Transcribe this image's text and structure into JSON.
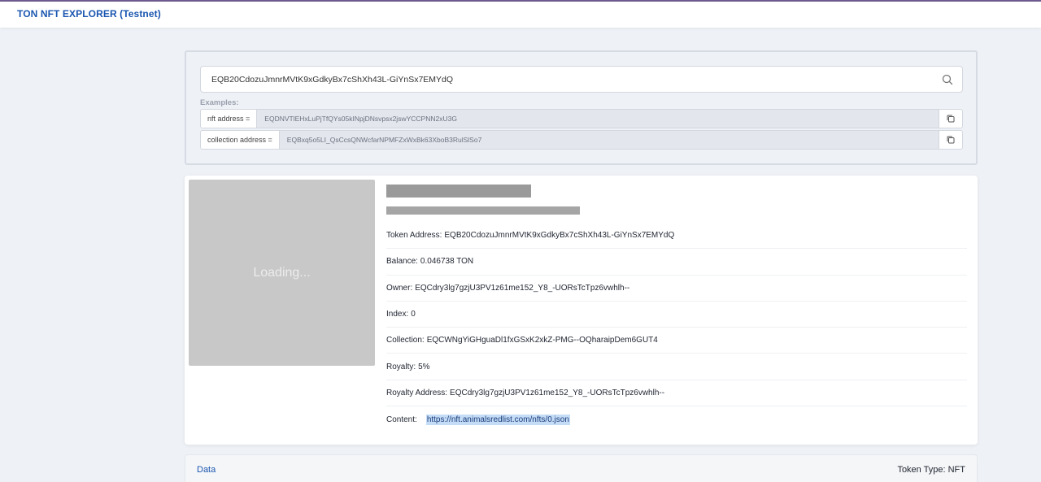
{
  "header": {
    "title": "TON NFT EXPLORER (Testnet)"
  },
  "search": {
    "value": "EQB20CdozuJmnrMVtK9xGdkyBx7cShXh43L-GiYnSx7EMYdQ",
    "examples_label": "Examples:",
    "examples": [
      {
        "prefix": "nft address =",
        "value": "EQDNVTlEHxLuPjTfQYs05kINpjDNsvpsx2jswYCCPNN2xU3G"
      },
      {
        "prefix": "collection address =",
        "value": "EQBxq5o5LI_QsCcsQNWcfarNPMFZxWxBk63XboB3RulSlSo7"
      }
    ]
  },
  "nft": {
    "preview_text": "Loading...",
    "details": [
      {
        "label": "Token Address:",
        "value": "EQB20CdozuJmnrMVtK9xGdkyBx7cShXh43L-GiYnSx7EMYdQ"
      },
      {
        "label": "Balance:",
        "value": "0.046738 TON"
      },
      {
        "label": "Owner:",
        "value": "EQCdry3lg7gzjU3PV1z61me152_Y8_-UORsTcTpz6vwhlh--"
      },
      {
        "label": "Index:",
        "value": "0"
      },
      {
        "label": "Collection:",
        "value": "EQCWNgYiGHguaDl1fxGSxK2xkZ-PMG--OQharaipDem6GUT4"
      },
      {
        "label": "Royalty:",
        "value": "5%"
      },
      {
        "label": "Royalty Address:",
        "value": "EQCdry3lg7gzjU3PV1z61me152_Y8_-UORsTcTpz6vwhlh--"
      },
      {
        "label": "Content:",
        "value": "https://nft.animalsredlist.com/nfts/0.json"
      }
    ]
  },
  "data_panel": {
    "tab_label": "Data",
    "token_type": "Token Type: NFT"
  }
}
